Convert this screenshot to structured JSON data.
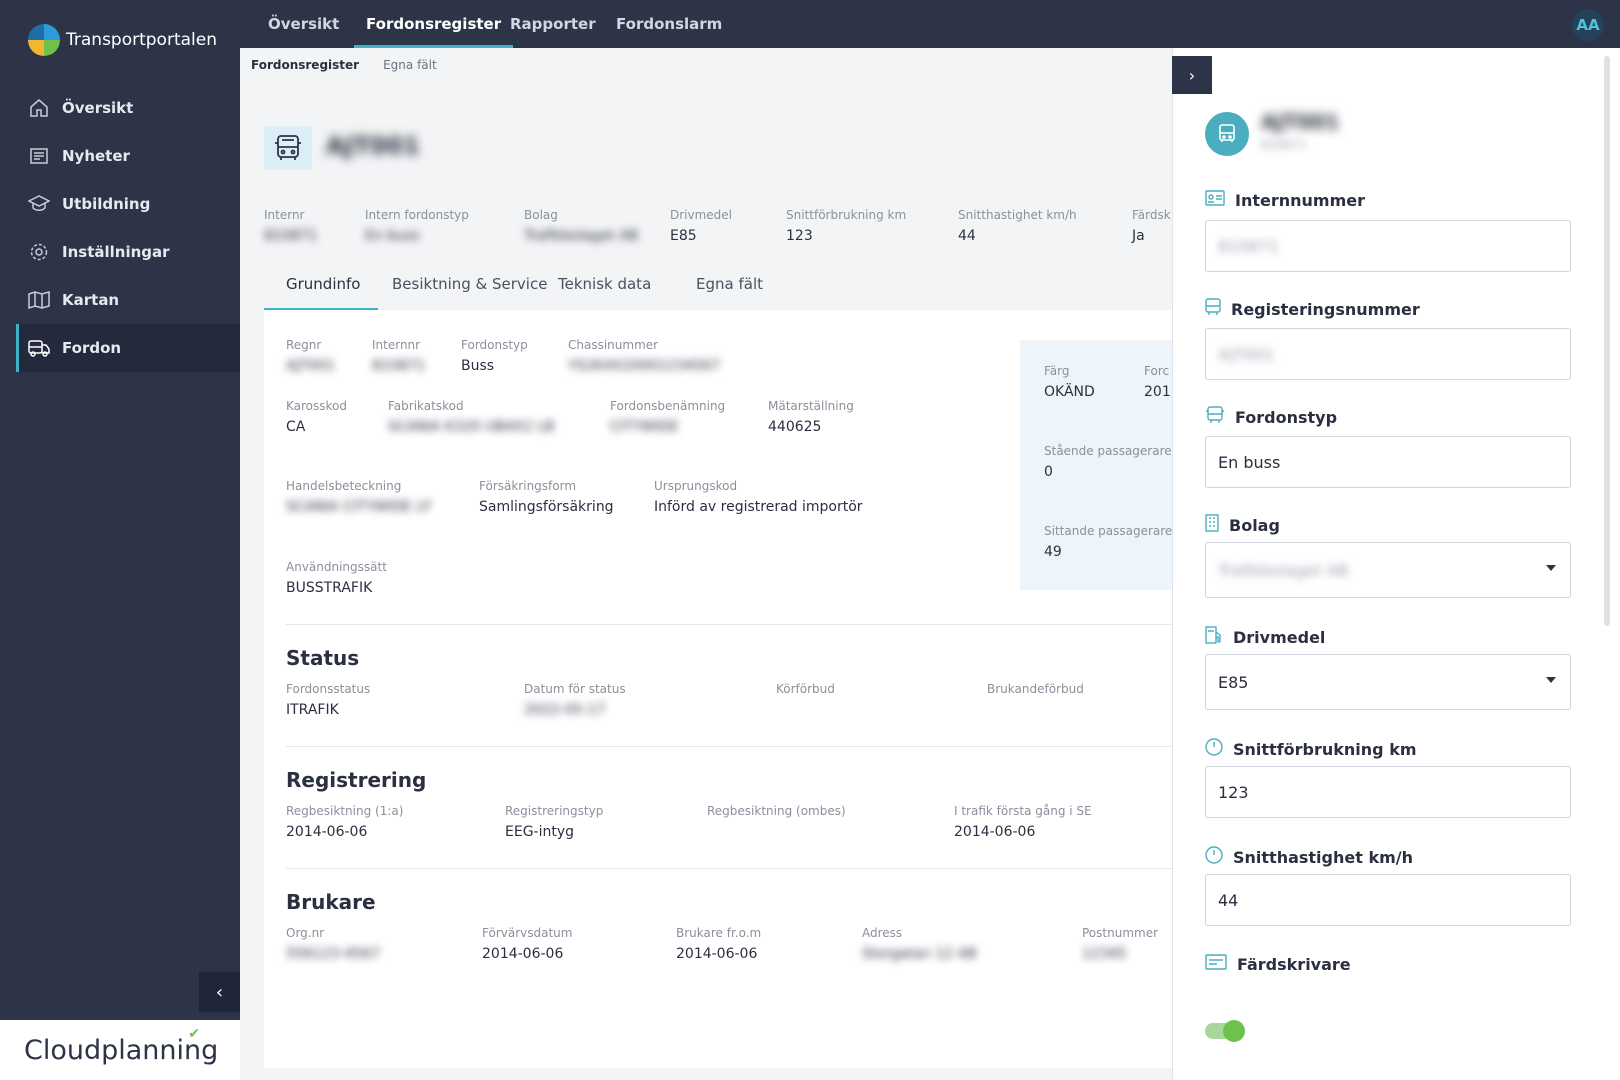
{
  "brand": {
    "name": "Transportportalen",
    "footer": "Cloudplanning"
  },
  "nav": [
    {
      "label": "Översikt",
      "icon": "home-icon"
    },
    {
      "label": "Nyheter",
      "icon": "newspaper-icon"
    },
    {
      "label": "Utbildning",
      "icon": "graduation-cap-icon"
    },
    {
      "label": "Inställningar",
      "icon": "gear-icon"
    },
    {
      "label": "Kartan",
      "icon": "map-icon"
    },
    {
      "label": "Fordon",
      "icon": "vehicle-icon",
      "active": true
    }
  ],
  "top_tabs": [
    {
      "label": "Översikt"
    },
    {
      "label": "Fordonsregister",
      "active": true
    },
    {
      "label": "Rapporter"
    },
    {
      "label": "Fordonslarm"
    }
  ],
  "user_initials": "AA",
  "breadcrumb": {
    "current": "Fordonsregister",
    "link": "Egna fält"
  },
  "vehicle": {
    "regnr": "AJT001",
    "internnr": "810871"
  },
  "summary": [
    {
      "label": "Internr",
      "value": "810871",
      "blurred": true
    },
    {
      "label": "Intern fordonstyp",
      "value": "En buss",
      "blurred": true
    },
    {
      "label": "Bolag",
      "value": "Trafikbolaget AB",
      "blurred": true
    },
    {
      "label": "Drivmedel",
      "value": "E85"
    },
    {
      "label": "Snittförbrukning km",
      "value": "123"
    },
    {
      "label": "Snitthastighet km/h",
      "value": "44"
    },
    {
      "label": "Färdsk",
      "value": "Ja"
    }
  ],
  "tabs": [
    {
      "label": "Grundinfo",
      "active": true
    },
    {
      "label": "Besiktning & Service"
    },
    {
      "label": "Teknisk data"
    },
    {
      "label": "Egna fält"
    }
  ],
  "grundinfo": {
    "regnr": {
      "label": "Regnr",
      "value": "AJT001"
    },
    "internnr": {
      "label": "Internnr",
      "value": "810871"
    },
    "fordonstyp": {
      "label": "Fordonstyp",
      "value": "Buss"
    },
    "chassinummer": {
      "label": "Chassinummer",
      "value": "YS2K4X20001234567"
    },
    "karosskod": {
      "label": "Karosskod",
      "value": "CA"
    },
    "fabrikatskod": {
      "label": "Fabrikatskod",
      "value": "SCANIA K320 UB4X2 LB"
    },
    "fordonsbenamning": {
      "label": "Fordonsbenämning",
      "value": "CITYWIDE"
    },
    "matarstallning": {
      "label": "Mätarställning",
      "value": "440625"
    },
    "handelsbeteckning": {
      "label": "Handelsbeteckning",
      "value": "SCANIA CITYWIDE LF"
    },
    "forsakringsform": {
      "label": "Försäkringsform",
      "value": "Samlingsförsäkring"
    },
    "ursprungskod": {
      "label": "Ursprungskod",
      "value": "Införd av registrerad importör"
    },
    "anvandningssatt": {
      "label": "Användningssätt",
      "value": "BUSSTRAFIK"
    }
  },
  "side_info": {
    "farg": {
      "label": "Färg",
      "value": "OKÄND"
    },
    "forc": {
      "label": "Forc",
      "value": "201"
    },
    "staende": {
      "label": "Stående passagerare",
      "value": "0"
    },
    "sittande": {
      "label": "Sittande passagerare",
      "value": "49"
    }
  },
  "status": {
    "title": "Status",
    "fordonsstatus": {
      "label": "Fordonsstatus",
      "value": "ITRAFIK"
    },
    "datum": {
      "label": "Datum för status",
      "value": "2022-05-17"
    },
    "korforbud": {
      "label": "Körförbud"
    },
    "brukandeforbud": {
      "label": "Brukandeförbud"
    }
  },
  "registrering": {
    "title": "Registrering",
    "regbesiktning_forsta": {
      "label": "Regbesiktning (1:a)",
      "value": "2014-06-06"
    },
    "registreringstyp": {
      "label": "Registreringstyp",
      "value": "EEG-intyg"
    },
    "regbesiktning_ombes": {
      "label": "Regbesiktning (ombes)"
    },
    "i_trafik": {
      "label": "I trafik första gång i SE",
      "value": "2014-06-06"
    }
  },
  "brukare": {
    "title": "Brukare",
    "orgnr": {
      "label": "Org.nr",
      "value": "556123-4567"
    },
    "forvarvsdatum": {
      "label": "Förvärvsdatum",
      "value": "2014-06-06"
    },
    "brukare_from": {
      "label": "Brukare fr.o.m",
      "value": "2014-06-06"
    },
    "adress": {
      "label": "Adress",
      "value": "Storgatan 12 AB"
    },
    "postnummer": {
      "label": "Postnummer",
      "value": "12345"
    }
  },
  "panel": {
    "title": "AJT001",
    "subtitle": "810871",
    "internnummer": {
      "label": "Internnummer",
      "value": "810871"
    },
    "registeringsnummer": {
      "label": "Registeringsnummer",
      "value": "AJT001"
    },
    "fordonstyp": {
      "label": "Fordonstyp",
      "value": "En buss"
    },
    "bolag": {
      "label": "Bolag",
      "value": "Trafikbolaget AB"
    },
    "drivmedel": {
      "label": "Drivmedel",
      "value": "E85"
    },
    "snittforbrukning": {
      "label": "Snittförbrukning km",
      "value": "123"
    },
    "snitthastighet": {
      "label": "Snitthastighet km/h",
      "value": "44"
    },
    "fardskrivare": {
      "label": "Färdskrivare",
      "enabled": true
    }
  }
}
